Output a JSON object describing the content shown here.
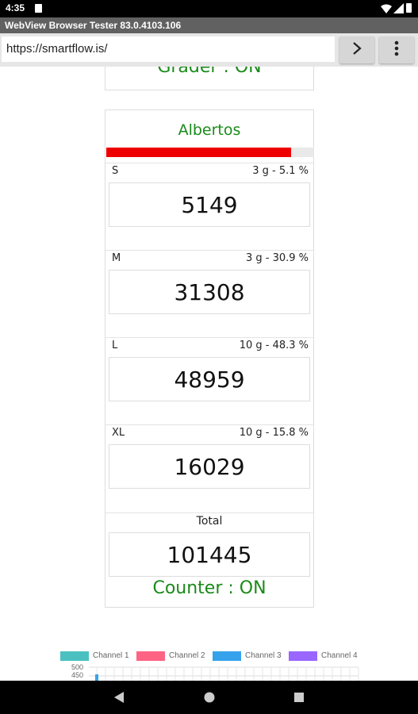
{
  "status_bar": {
    "time": "4:35"
  },
  "app": {
    "title": "WebView Browser Tester 83.0.4103.106"
  },
  "url_bar": {
    "url": "https://smartflow.is/"
  },
  "grader": {
    "status": "Grader : ON"
  },
  "card": {
    "title": "Albertos",
    "progress_percent": 89,
    "progress_color": "#ee0000",
    "rows": [
      {
        "label": "S",
        "meta": "3 g - 5.1 %",
        "count": "5149"
      },
      {
        "label": "M",
        "meta": "3 g - 30.9 %",
        "count": "31308"
      },
      {
        "label": "L",
        "meta": "10 g - 48.3 %",
        "count": "48959"
      },
      {
        "label": "XL",
        "meta": "10 g - 15.8 %",
        "count": "16029"
      }
    ],
    "total": {
      "label": "Total",
      "count": "101445"
    },
    "counter_status": "Counter : ON"
  },
  "chart": {
    "legend": [
      {
        "name": "Channel 1",
        "color": "#4bc0c0"
      },
      {
        "name": "Channel 2",
        "color": "#ff6384"
      },
      {
        "name": "Channel 3",
        "color": "#36a2eb"
      },
      {
        "name": "Channel 4",
        "color": "#9966ff"
      }
    ],
    "y_ticks": [
      "500",
      "450"
    ]
  },
  "colors": {
    "status_green": "#1a8a1a",
    "accent_red": "#ee0000"
  }
}
